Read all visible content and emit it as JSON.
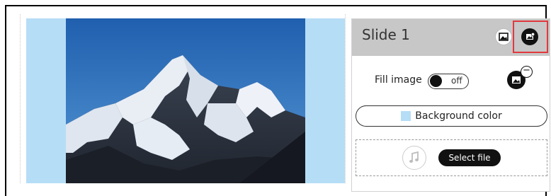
{
  "panel": {
    "title": "Slide 1",
    "fill_image_label": "Fill image",
    "toggle_state": "off",
    "background_color_label": "Background color",
    "select_file_label": "Select file",
    "minus_glyph": "−"
  },
  "colors": {
    "slide_background": "#b6ddf6",
    "header_background": "#c7c7c7",
    "highlight": "#e0393e"
  },
  "icons": [
    "add-background-image-icon",
    "remove-slide-icon",
    "image-icon",
    "remove-image-icon",
    "music-icon"
  ]
}
